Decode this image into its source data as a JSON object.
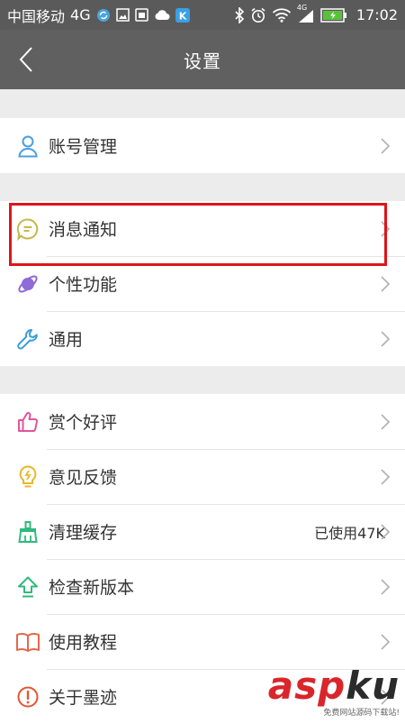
{
  "status_bar": {
    "carrier": "中国移动",
    "network": "4G",
    "signal_label": "4G",
    "time": "17:02",
    "app_badge": "K",
    "left_icons": [
      "sync-icon",
      "image-icon",
      "sim-icon",
      "cloud-icon",
      "app-k-icon"
    ],
    "right_icons": [
      "bluetooth-icon",
      "alarm-icon",
      "wifi-icon",
      "cellular-signal-icon",
      "battery-charging-icon"
    ]
  },
  "header": {
    "title": "设置",
    "back_icon": "back-arrow-icon"
  },
  "groups": [
    {
      "items": [
        {
          "label": "账号管理",
          "icon": "person-icon",
          "icon_color": "#4a9fe0"
        }
      ]
    },
    {
      "items": [
        {
          "label": "消息通知",
          "icon": "message-bubble-icon",
          "icon_color": "#c5b84a"
        },
        {
          "label": "个性功能",
          "icon": "planet-icon",
          "icon_color": "#8f6ad9"
        },
        {
          "label": "通用",
          "icon": "wrench-icon",
          "icon_color": "#3a9fd6"
        }
      ]
    },
    {
      "items": [
        {
          "label": "赏个好评",
          "icon": "thumbs-up-icon",
          "icon_color": "#e0559a"
        },
        {
          "label": "意见反馈",
          "icon": "lightbulb-icon",
          "icon_color": "#e8b92a"
        },
        {
          "label": "清理缓存",
          "icon": "broom-icon",
          "icon_color": "#2fba7e",
          "value": "已使用47K"
        },
        {
          "label": "检查新版本",
          "icon": "upload-arrow-icon",
          "icon_color": "#2fba7e"
        },
        {
          "label": "使用教程",
          "icon": "book-icon",
          "icon_color": "#e06a4a"
        },
        {
          "label": "关于墨迹",
          "icon": "exclamation-circle-icon",
          "icon_color": "#e6542e"
        }
      ]
    }
  ],
  "highlight": {
    "color": "#e1141a"
  },
  "watermark": {
    "logo": "asp",
    "logo2": "ku",
    "subtext": "免费网站源码下载站!"
  },
  "colors": {
    "status_bar": "#5a5a5a",
    "app_bar": "#606060",
    "background": "#ececec",
    "chevron": "#b5b5b5"
  }
}
